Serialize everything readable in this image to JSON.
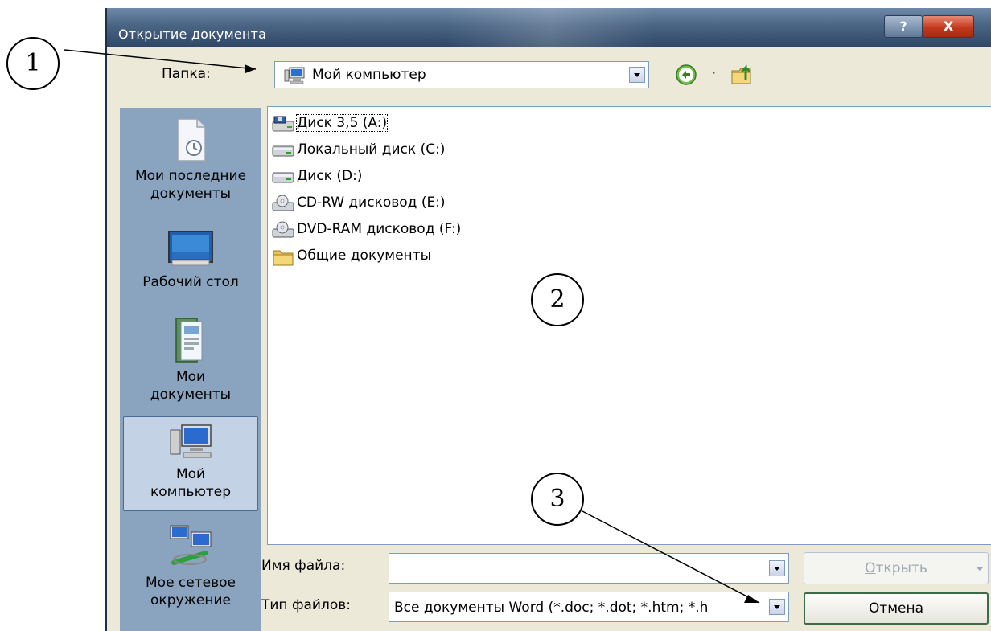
{
  "window": {
    "title": "Открытие документа",
    "help_glyph": "?",
    "close_glyph": "X"
  },
  "toolbar": {
    "folder_label": "Папка:",
    "folder_value": "Мой компьютер",
    "sep": "·"
  },
  "places": [
    {
      "label_line1": "Мои последние",
      "label_line2": "документы"
    },
    {
      "label_line1": "Рабочий стол",
      "label_line2": ""
    },
    {
      "label_line1": "Мои",
      "label_line2": "документы"
    },
    {
      "label_line1": "Мой",
      "label_line2": "компьютер"
    },
    {
      "label_line1": "Мое сетевое",
      "label_line2": "окружение"
    }
  ],
  "files": [
    {
      "label": "Диск 3,5 (A:)",
      "icon": "floppy-drive-icon"
    },
    {
      "label": "Локальный диск (C:)",
      "icon": "hard-disk-icon"
    },
    {
      "label": "Диск (D:)",
      "icon": "hard-disk-icon"
    },
    {
      "label": "CD-RW дисковод (E:)",
      "icon": "cd-drive-icon"
    },
    {
      "label": "DVD-RAM дисковод (F:)",
      "icon": "cd-drive-icon"
    },
    {
      "label": "Общие документы",
      "icon": "folder-icon"
    }
  ],
  "bottom": {
    "filename_label": "Имя файла:",
    "filename_value": "",
    "filetype_label": "Тип файлов:",
    "filetype_value": "Все документы Word (*.doc; *.dot; *.htm; *.h",
    "open_label": "Открыть",
    "open_accel": "О",
    "cancel_label": "Отмена"
  },
  "callouts": [
    "1",
    "2",
    "3"
  ],
  "colors": {
    "titlebar": "#4a6484",
    "dialog_bg": "#ece9d8",
    "places_bg": "#8aa3bf",
    "selected_place": "#c3d3e5",
    "close_button": "#c4391e"
  }
}
